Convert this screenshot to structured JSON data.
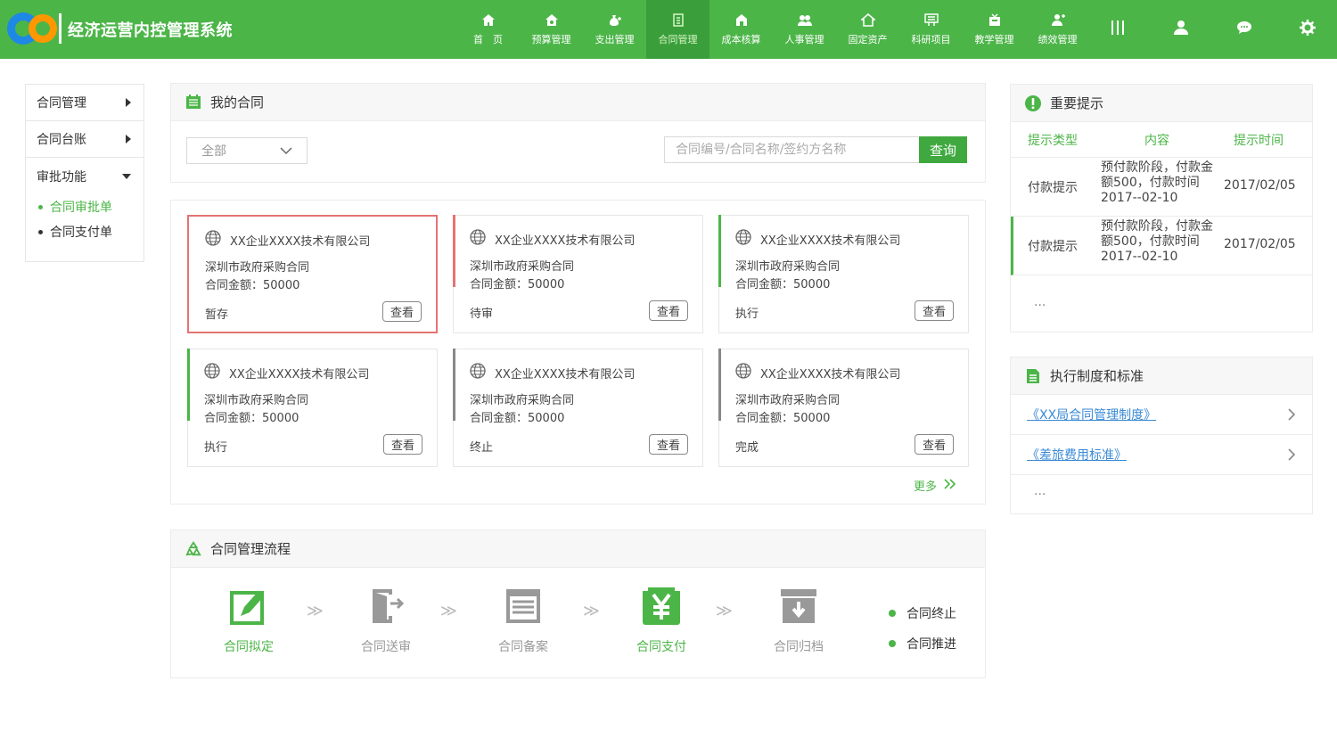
{
  "header": {
    "app_title": "经济运营内控管理系统",
    "nav": [
      {
        "label": "首　页",
        "icon": "home-icon"
      },
      {
        "label": "预算管理",
        "icon": "budget-icon"
      },
      {
        "label": "支出管理",
        "icon": "expense-icon"
      },
      {
        "label": "合同管理",
        "icon": "contract-icon",
        "active": true
      },
      {
        "label": "成本核算",
        "icon": "cost-icon"
      },
      {
        "label": "人事管理",
        "icon": "people-icon"
      },
      {
        "label": "固定资产",
        "icon": "asset-icon"
      },
      {
        "label": "科研项目",
        "icon": "research-icon"
      },
      {
        "label": "教学管理",
        "icon": "teaching-icon"
      },
      {
        "label": "绩效管理",
        "icon": "performance-icon"
      }
    ],
    "accent": "#4cb548"
  },
  "sidebar": {
    "items": [
      "合同管理",
      "合同台账",
      "审批功能"
    ],
    "sub": [
      "合同审批单",
      "合同支付单"
    ]
  },
  "my_contracts": {
    "title": "我的合同",
    "filter_value": "全部",
    "search_placeholder": "合同编号/合同名称/签约方名称",
    "search_button": "查询",
    "cards": [
      {
        "company": "XX企业XXXX技术有限公司",
        "name": "深圳市政府采购合同",
        "amount": "合同金额：50000",
        "status": "暂存",
        "view": "查看"
      },
      {
        "company": "XX企业XXXX技术有限公司",
        "name": "深圳市政府采购合同",
        "amount": "合同金额：50000",
        "status": "待审",
        "view": "查看"
      },
      {
        "company": "XX企业XXXX技术有限公司",
        "name": "深圳市政府采购合同",
        "amount": "合同金额：50000",
        "status": "执行",
        "view": "查看"
      },
      {
        "company": "XX企业XXXX技术有限公司",
        "name": "深圳市政府采购合同",
        "amount": "合同金额：50000",
        "status": "执行",
        "view": "查看"
      },
      {
        "company": "XX企业XXXX技术有限公司",
        "name": "深圳市政府采购合同",
        "amount": "合同金额：50000",
        "status": "终止",
        "view": "查看"
      },
      {
        "company": "XX企业XXXX技术有限公司",
        "name": "深圳市政府采购合同",
        "amount": "合同金额：50000",
        "status": "完成",
        "view": "查看"
      }
    ],
    "more": "更多"
  },
  "flow": {
    "title": "合同管理流程",
    "steps": [
      "合同拟定",
      "合同送审",
      "合同备案",
      "合同支付",
      "合同归档"
    ],
    "legend": [
      "合同终止",
      "合同推进"
    ]
  },
  "tips": {
    "title": "重要提示",
    "headers": [
      "提示类型",
      "内容",
      "提示时间"
    ],
    "rows": [
      {
        "type": "付款提示",
        "content": "预付款阶段，付款金额500，付款时间2017--02-10",
        "time": "2017/02/05"
      },
      {
        "type": "付款提示",
        "content": "预付款阶段，付款金额500，付款时间2017--02-10",
        "time": "2017/02/05"
      }
    ],
    "ellipsis": "..."
  },
  "rules": {
    "title": "执行制度和标准",
    "items": [
      "《XX局合同管理制度》",
      "《差旅费用标准》"
    ],
    "ellipsis": "..."
  }
}
